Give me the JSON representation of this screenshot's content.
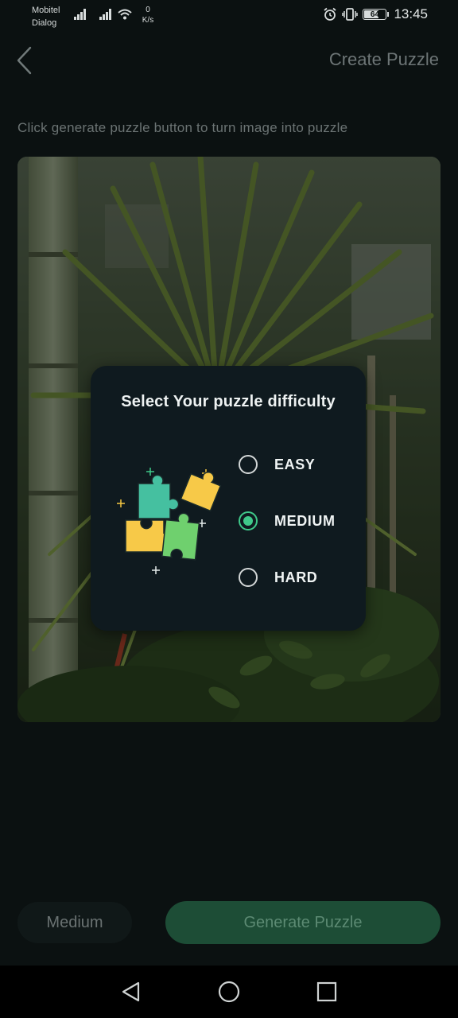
{
  "status_bar": {
    "carrier_1": "Mobitel",
    "carrier_2": "Dialog",
    "net_speed_value": "0",
    "net_speed_unit": "K/s",
    "battery": "64",
    "time": "13:45"
  },
  "app_bar": {
    "title": "Create Puzzle"
  },
  "instruction": "Click generate puzzle button to turn image into puzzle",
  "dialog": {
    "title": "Select Your puzzle difficulty",
    "options": [
      {
        "label": "EASY",
        "selected": false
      },
      {
        "label": "MEDIUM",
        "selected": true
      },
      {
        "label": "HARD",
        "selected": false
      }
    ]
  },
  "bottom": {
    "difficulty_label": "Medium",
    "generate_label": "Generate Puzzle"
  },
  "colors": {
    "background": "#0b1111",
    "dialog": "#0f1a1f",
    "accent": "#3fc98a",
    "generate_button": "#1d4d36"
  },
  "icons": {
    "back": "chevron-left-icon",
    "alarm": "alarm-icon",
    "vibrate": "vibrate-icon",
    "wifi": "wifi-icon",
    "signal": "signal-icon",
    "nav_back": "triangle-back-icon",
    "nav_home": "circle-home-icon",
    "nav_recents": "square-recents-icon"
  }
}
